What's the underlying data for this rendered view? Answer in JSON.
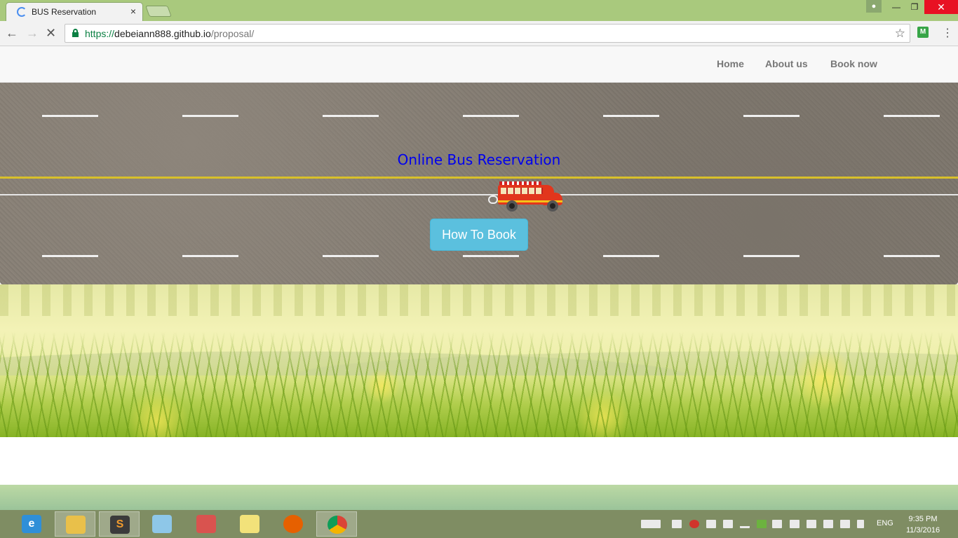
{
  "browser": {
    "tab_title": "BUS Reservation",
    "tab_close": "×",
    "url_scheme": "https://",
    "url_host": "debeiann888.github.io",
    "url_path": "/proposal/",
    "back_icon": "arrow-left",
    "forward_icon": "arrow-right",
    "stop_icon": "x",
    "star_icon": "star",
    "extension_label": "M",
    "menu_icon": "kebab"
  },
  "navbar": {
    "links": [
      "Home",
      "About us",
      "Book now"
    ]
  },
  "hero": {
    "title": "Online Bus Reservation",
    "button_label": "How To Book"
  },
  "taskbar": {
    "language": "ENG",
    "time": "9:35 PM",
    "date": "11/3/2016",
    "apps": [
      "internet-explorer",
      "file-explorer",
      "sublime-text",
      "notepad",
      "snipping-tool",
      "sticky-notes",
      "firefox",
      "chrome"
    ]
  },
  "colors": {
    "title_bar": "#a9c97d",
    "link_title": "#0000ee",
    "button": "#5bc0de",
    "taskbar": "#7f8d63"
  }
}
